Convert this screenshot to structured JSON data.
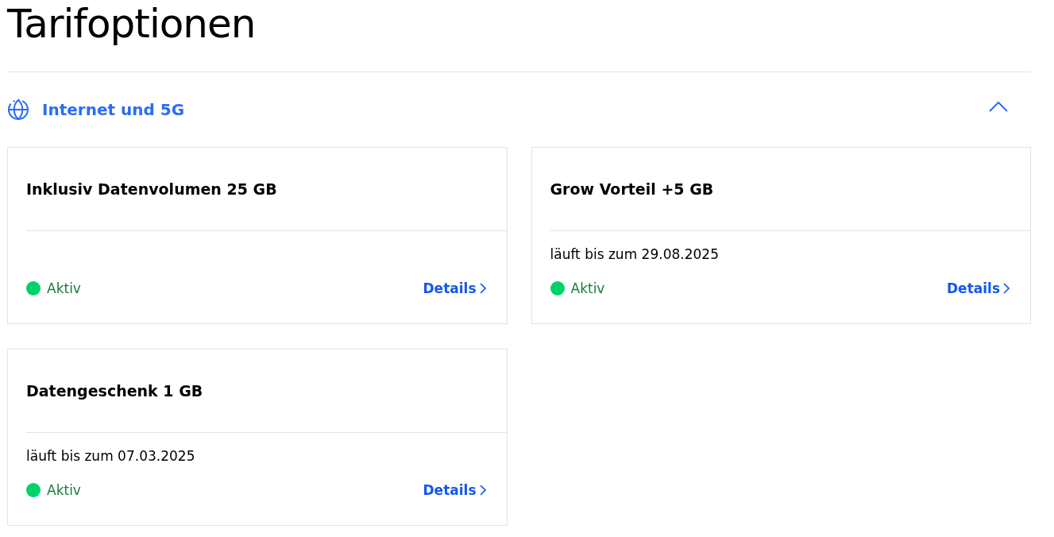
{
  "page_title": "Tarifoptionen",
  "section": {
    "title": "Internet und 5G",
    "expanded": true,
    "cards": [
      {
        "title": "Inklusiv Datenvolumen 25 GB",
        "status": {
          "kind": "active",
          "label": "Aktiv"
        },
        "link": "Details"
      },
      {
        "title": "Grow Vorteil +5 GB",
        "note": "läuft bis zum 29.08.2025",
        "status": {
          "kind": "active",
          "label": "Aktiv"
        },
        "link": "Details"
      },
      {
        "title": "Datengeschenk 1 GB",
        "note": "läuft bis zum 07.03.2025",
        "status": {
          "kind": "active",
          "label": "Aktiv"
        },
        "link": "Details"
      }
    ]
  }
}
